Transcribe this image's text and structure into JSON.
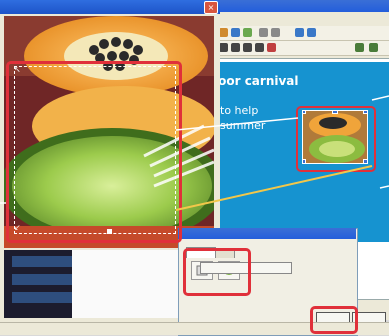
{
  "background_window": {
    "slide": {
      "line1": "loor carnival",
      "line2": "to help",
      "line3": "summer"
    }
  },
  "photo_dialog": {
    "title": "",
    "close_label": "×",
    "side_buttons": [
      "",
      "",
      ""
    ]
  },
  "crop": {
    "corner_top_left": "↖",
    "corner_bottom_left": "↙"
  },
  "tool_dialog": {
    "tabs": [
      "",
      ""
    ]
  },
  "dialog_buttons": {
    "ok_label": "",
    "cancel_label": ""
  },
  "status_bar": {
    "text": ""
  },
  "colors": {
    "highlight": "#e0303a",
    "slide_blue": "#1693d0",
    "title_blue": "#245edb"
  }
}
